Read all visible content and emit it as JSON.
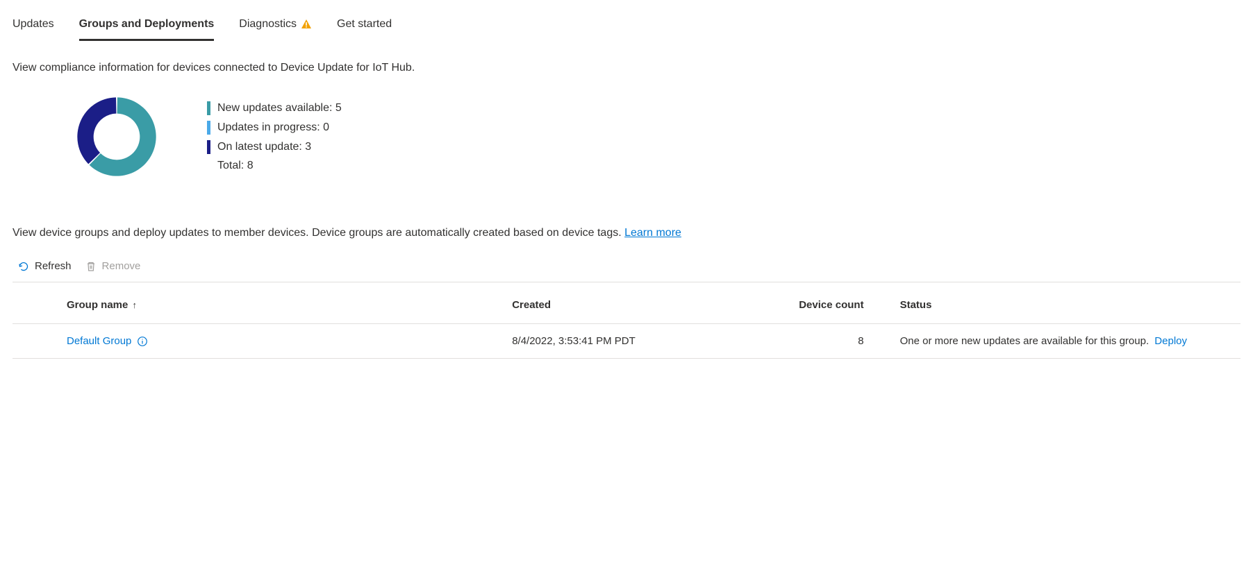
{
  "tabs": {
    "updates": "Updates",
    "groups": "Groups and Deployments",
    "diagnostics": "Diagnostics",
    "getstarted": "Get started"
  },
  "description": "View compliance information for devices connected to Device Update for IoT Hub.",
  "chart_data": {
    "type": "pie",
    "title": "",
    "series": [
      {
        "name": "New updates available",
        "value": 5,
        "color": "#3a9ca6"
      },
      {
        "name": "Updates in progress",
        "value": 0,
        "color": "#4aa9e8"
      },
      {
        "name": "On latest update",
        "value": 3,
        "color": "#1b1e87"
      }
    ],
    "total_label": "Total",
    "total": 8
  },
  "groups_description": "View device groups and deploy updates to member devices. Device groups are automatically created based on device tags.",
  "learn_more": "Learn more",
  "toolbar": {
    "refresh": "Refresh",
    "remove": "Remove"
  },
  "table": {
    "headers": {
      "group": "Group name",
      "created": "Created",
      "device_count": "Device count",
      "status": "Status"
    },
    "rows": [
      {
        "group": "Default Group",
        "created": "8/4/2022, 3:53:41 PM PDT",
        "device_count": "8",
        "status": "One or more new updates are available for this group.",
        "deploy": "Deploy"
      }
    ]
  }
}
